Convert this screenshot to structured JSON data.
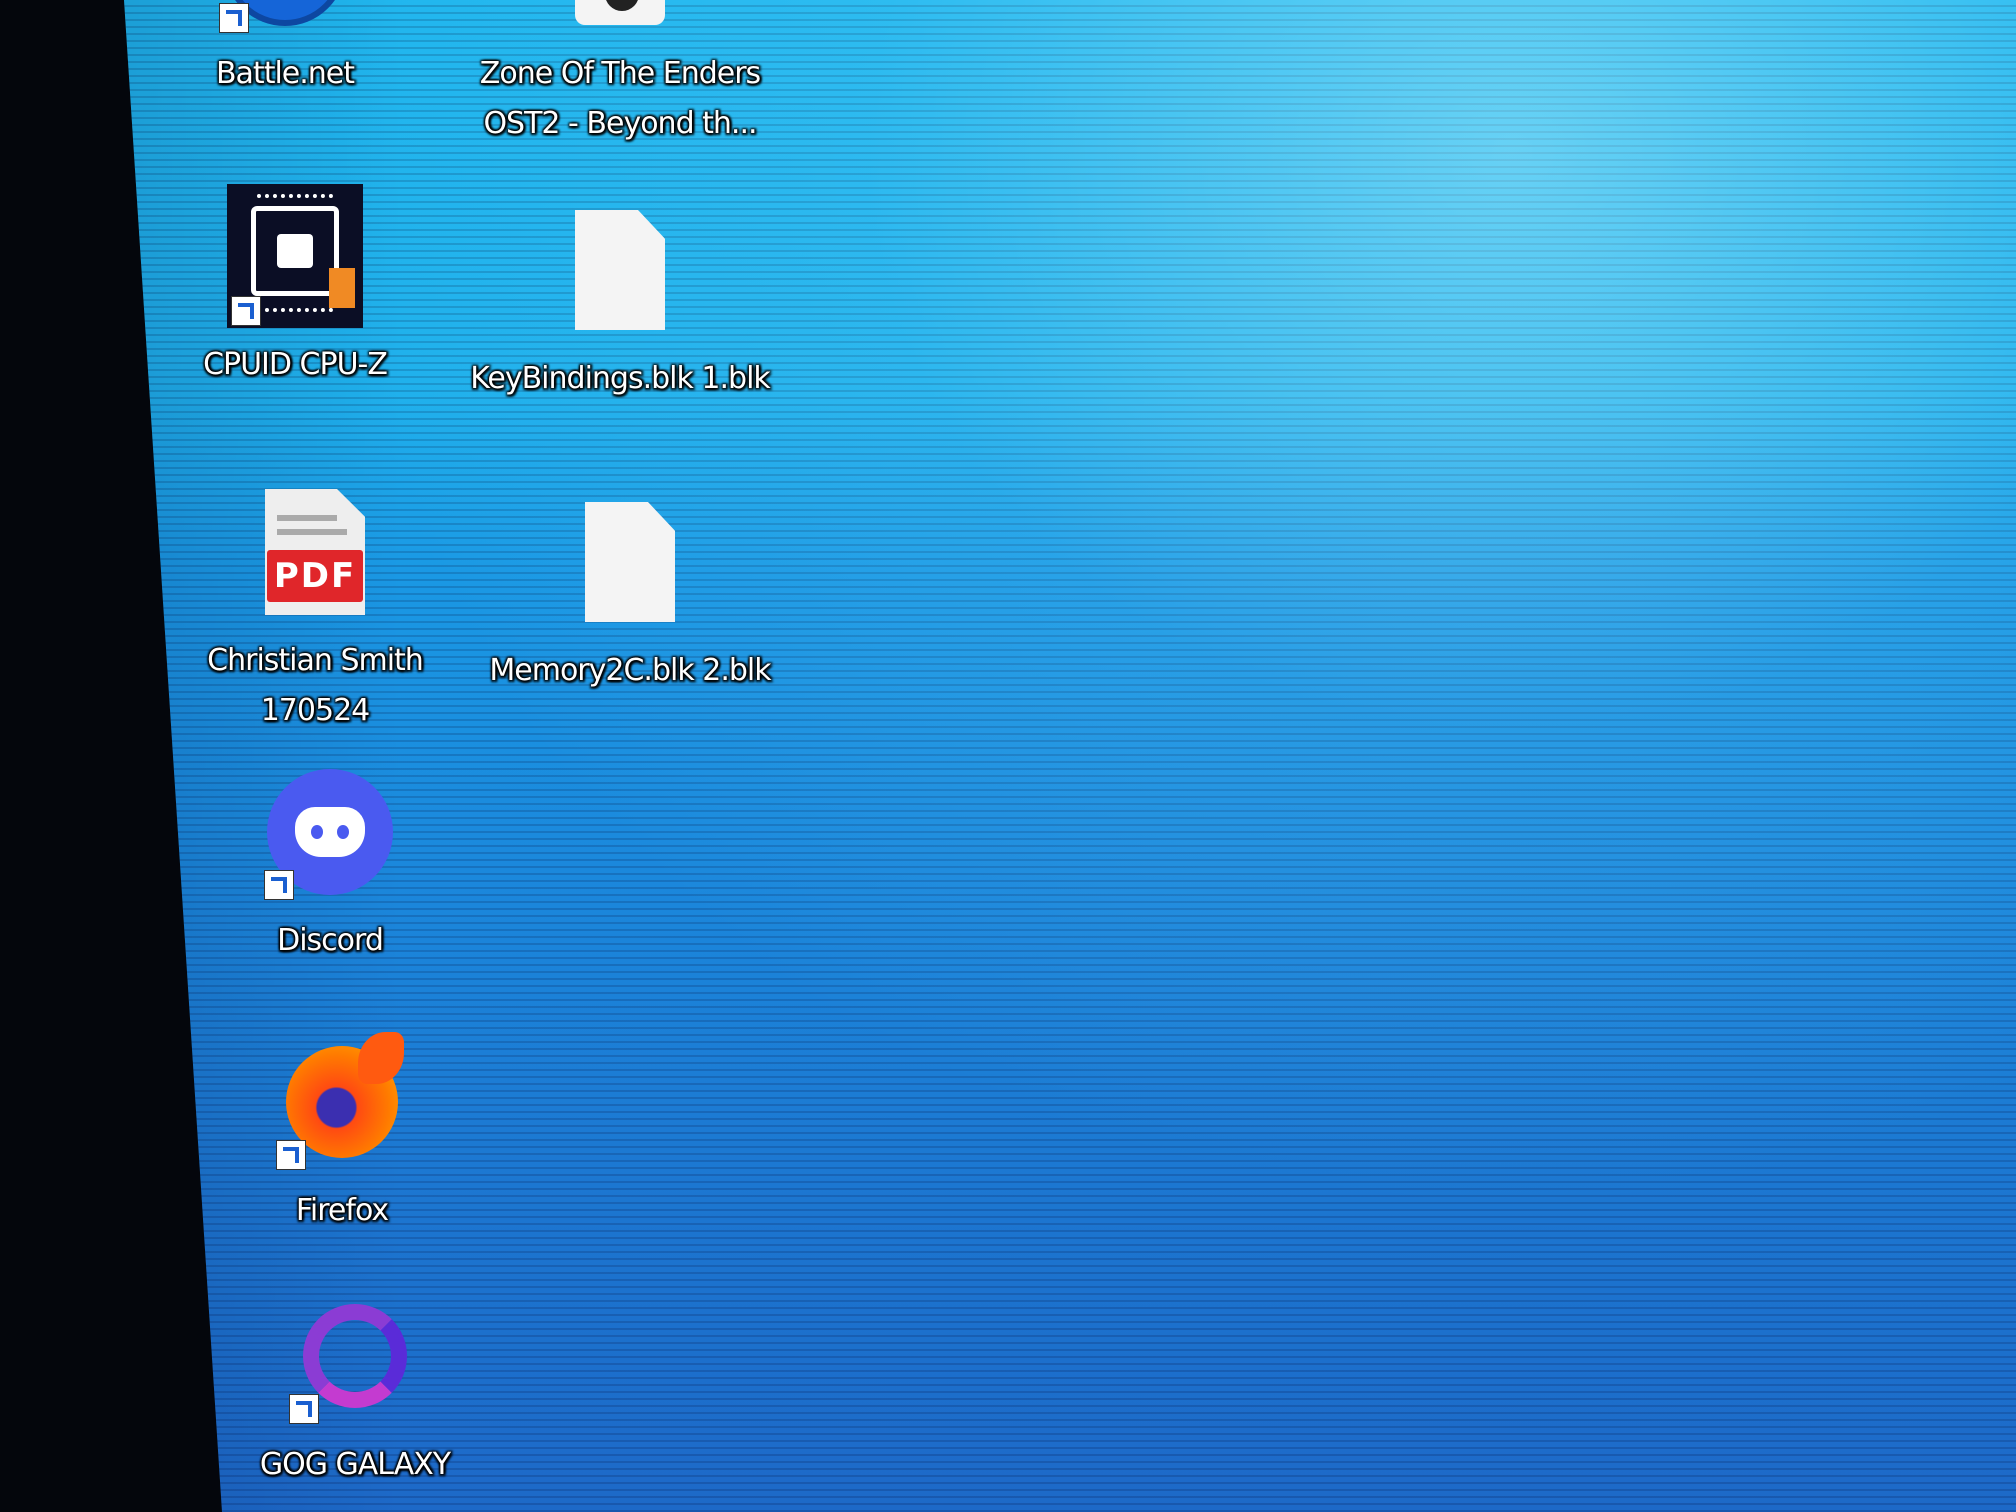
{
  "desktop": {
    "icons": [
      {
        "id": "battlenet",
        "label": "Battle.net",
        "icon": "battlenet-icon",
        "shortcut": true
      },
      {
        "id": "zone",
        "label": "Zone Of The Enders\nOST2 - Beyond th...",
        "icon": "file-icon",
        "shortcut": false
      },
      {
        "id": "cpuz",
        "label": "CPUID CPU-Z",
        "icon": "cpu-z-icon",
        "shortcut": true
      },
      {
        "id": "keybindings",
        "label": "KeyBindings.blk 1.blk",
        "icon": "file-icon",
        "shortcut": false
      },
      {
        "id": "pdf",
        "label": "Christian Smith\n170524",
        "icon": "pdf-icon",
        "badge": "PDF",
        "shortcut": false
      },
      {
        "id": "memory",
        "label": "Memory2C.blk 2.blk",
        "icon": "file-icon",
        "shortcut": false
      },
      {
        "id": "discord",
        "label": "Discord",
        "icon": "discord-icon",
        "shortcut": true
      },
      {
        "id": "firefox",
        "label": "Firefox",
        "icon": "firefox-icon",
        "shortcut": true
      },
      {
        "id": "gog",
        "label": "GOG GALAXY",
        "icon": "gog-galaxy-icon",
        "shortcut": true
      }
    ]
  },
  "colors": {
    "wallpaper": "#1fb0ec",
    "pdf_red": "#e0262a",
    "discord_blue": "#5865f2",
    "firefox_orange": "#ff6a00",
    "gog_purple": "#8b3cd4"
  }
}
